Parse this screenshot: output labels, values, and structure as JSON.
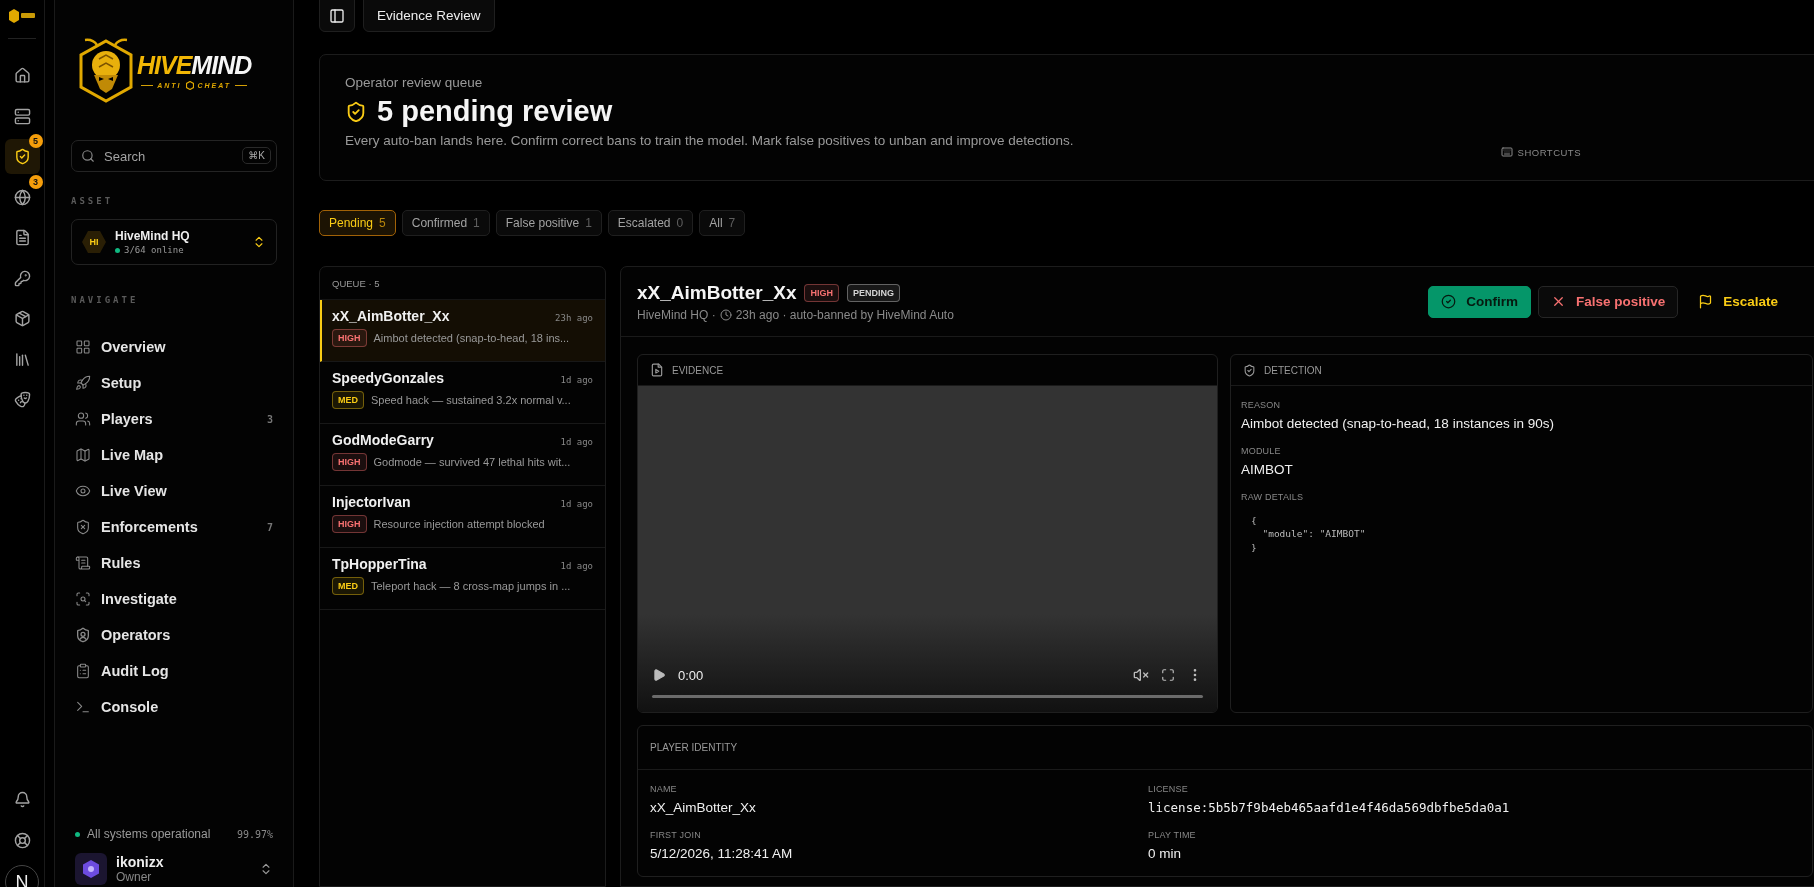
{
  "rail": {
    "items": [
      {
        "selected": false
      },
      {
        "selected": false
      },
      {
        "selected": true,
        "badge": "5"
      },
      {
        "selected": false,
        "badge": "3"
      },
      {
        "selected": false
      },
      {
        "selected": false
      },
      {
        "selected": false
      },
      {
        "selected": false
      },
      {
        "selected": false
      }
    ],
    "avatar": "N"
  },
  "sidebar": {
    "logo": {
      "word_1": "HIVE",
      "word_2": "MIND",
      "tagline_left": "ANTI",
      "tagline_right": "CHEAT"
    },
    "search": {
      "placeholder": "Search",
      "shortcut": "⌘K"
    },
    "asset_label": "ASSET",
    "asset": {
      "initials": "HI",
      "name": "HiveMind HQ",
      "status": "3/64 online"
    },
    "nav_label": "NAVIGATE",
    "nav": [
      {
        "label": "Overview"
      },
      {
        "label": "Setup"
      },
      {
        "label": "Players",
        "count": "3"
      },
      {
        "label": "Live Map"
      },
      {
        "label": "Live View"
      },
      {
        "label": "Enforcements",
        "count": "7"
      },
      {
        "label": "Rules"
      },
      {
        "label": "Investigate"
      },
      {
        "label": "Operators"
      },
      {
        "label": "Audit Log"
      },
      {
        "label": "Console"
      }
    ],
    "status": {
      "text": "All systems operational",
      "uptime": "99.97%"
    },
    "user": {
      "name": "ikonizx",
      "role": "Owner"
    }
  },
  "topbar": {
    "title": "Evidence Review"
  },
  "header": {
    "eyebrow": "Operator review queue",
    "title": "5 pending review",
    "description": "Every auto-ban lands here. Confirm correct bans to train the model. Mark false positives to unban and improve detections.",
    "shortcuts": "SHORTCUTS"
  },
  "filters": [
    {
      "label": "Pending",
      "count": "5",
      "selected": true
    },
    {
      "label": "Confirmed",
      "count": "1",
      "selected": false
    },
    {
      "label": "False positive",
      "count": "1",
      "selected": false
    },
    {
      "label": "Escalated",
      "count": "0",
      "selected": false
    },
    {
      "label": "All",
      "count": "7",
      "selected": false
    }
  ],
  "queue": {
    "title": "QUEUE · 5",
    "items": [
      {
        "name": "xX_AimBotter_Xx",
        "time": "23h ago",
        "tag": {
          "text": "HIGH",
          "color": "#f87171"
        },
        "reason": "Aimbot detected (snap-to-head, 18 ins...",
        "selected": true
      },
      {
        "name": "SpeedyGonzales",
        "time": "1d ago",
        "tag": {
          "text": "MED",
          "color": "#facc15"
        },
        "reason": "Speed hack — sustained 3.2x normal v...",
        "selected": false
      },
      {
        "name": "GodModeGarry",
        "time": "1d ago",
        "tag": {
          "text": "HIGH",
          "color": "#f87171"
        },
        "reason": "Godmode — survived 47 lethal hits wit...",
        "selected": false
      },
      {
        "name": "InjectorIvan",
        "time": "1d ago",
        "tag": {
          "text": "HIGH",
          "color": "#f87171"
        },
        "reason": "Resource injection attempt blocked",
        "selected": false
      },
      {
        "name": "TpHopperTina",
        "time": "1d ago",
        "tag": {
          "text": "MED",
          "color": "#facc15"
        },
        "reason": "Teleport hack — 8 cross-map jumps in ...",
        "selected": false
      }
    ]
  },
  "detail": {
    "name": "xX_AimBotter_Xx",
    "badges": [
      {
        "text": "HIGH",
        "color": "#f87171"
      },
      {
        "text": "PENDING",
        "color": "#d4d4d4"
      }
    ],
    "meta_server": "HiveMind HQ ·",
    "meta_time": "23h ago · auto-banned by HiveMind Auto",
    "actions": [
      {
        "label": "Confirm",
        "kind": "primary"
      },
      {
        "label": "False positive",
        "kind": "danger"
      },
      {
        "label": "Escalate",
        "kind": "ghost"
      }
    ],
    "evidence": {
      "title": "EVIDENCE",
      "time": "0:00"
    },
    "detection": {
      "title": "DETECTION",
      "fields": [
        {
          "label": "REASON",
          "value": "Aimbot detected (snap-to-head, 18 instances in 90s)",
          "kind": "text"
        },
        {
          "label": "MODULE",
          "value": "AIMBOT",
          "kind": "text"
        },
        {
          "label": "RAW DETAILS",
          "value": "{\n  \"module\": \"AIMBOT\"\n}",
          "kind": "code"
        }
      ]
    },
    "identity": {
      "title": "PLAYER IDENTITY",
      "fields": [
        {
          "label": "NAME",
          "value": "xX_AimBotter_Xx",
          "kind": "text"
        },
        {
          "label": "LICENSE",
          "value": "license:5b5b7f9b4eb465aafd1e4f46da569dbfbe5da0a1",
          "kind": "mono"
        },
        {
          "label": "FIRST JOIN",
          "value": "5/12/2026, 11:28:41 AM",
          "kind": "text"
        },
        {
          "label": "PLAY TIME",
          "value": "0 min",
          "kind": "text"
        }
      ]
    }
  }
}
